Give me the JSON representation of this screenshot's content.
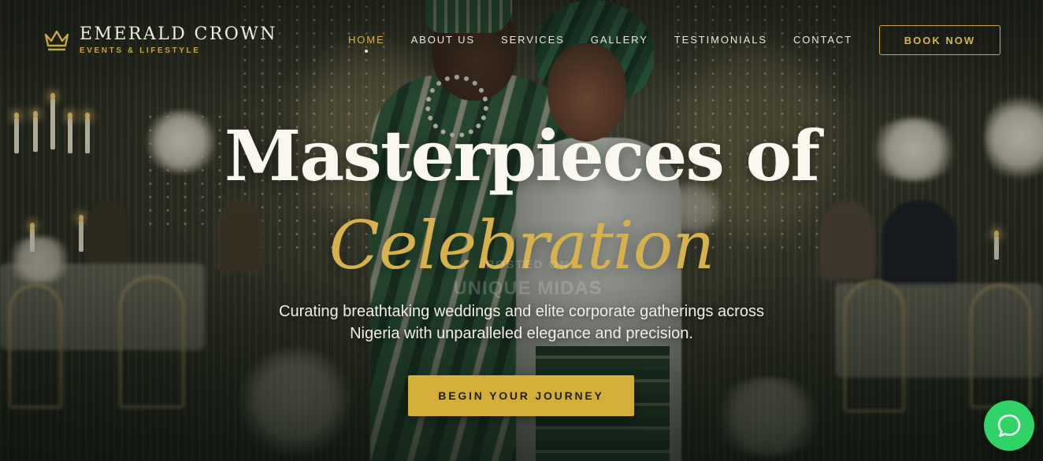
{
  "brand": {
    "name": "EMERALD CROWN",
    "tagline": "EVENTS & LIFESTYLE",
    "logo_icon": "crown-icon",
    "accent_color": "#d4af37"
  },
  "nav": {
    "items": [
      {
        "label": "HOME",
        "active": true
      },
      {
        "label": "ABOUT US",
        "active": false
      },
      {
        "label": "SERVICES",
        "active": false
      },
      {
        "label": "GALLERY",
        "active": false
      },
      {
        "label": "TESTIMONIALS",
        "active": false
      },
      {
        "label": "CONTACT",
        "active": false
      }
    ],
    "book_label": "BOOK NOW"
  },
  "hero": {
    "headline_line1": "Masterpieces of",
    "headline_line2": "Celebration",
    "subtext": "Curating breathtaking weddings and elite corporate gatherings across Nigeria with unparalleled elegance and precision.",
    "cta_label": "BEGIN YOUR JOURNEY",
    "watermark_line1": "POSTED ON",
    "watermark_line2": "UNIQUE MIDAS"
  },
  "chat_widget": {
    "icon": "chat-bubble-icon",
    "color": "#2fd366"
  }
}
